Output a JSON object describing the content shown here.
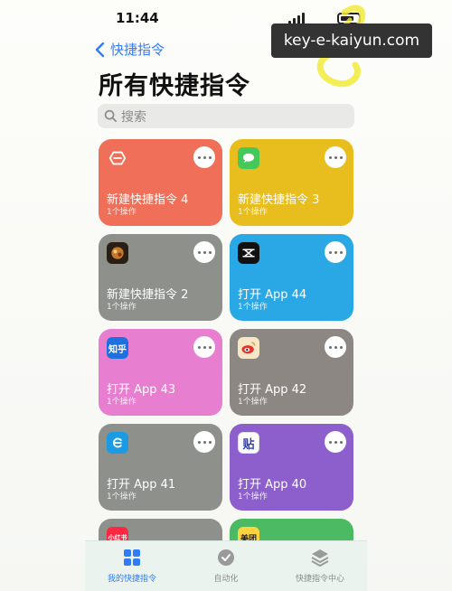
{
  "status_bar": {
    "time": "11:44"
  },
  "watermark": {
    "text": "key-e-kaiyun.com"
  },
  "nav": {
    "back_label": "快捷指令"
  },
  "page": {
    "title": "所有快捷指令"
  },
  "search": {
    "placeholder": "搜索"
  },
  "shortcuts": [
    {
      "name": "新建快捷指令 4",
      "subtitle": "1个操作",
      "color": "#ef6f58",
      "icon": "shortcuts-icon",
      "icon_text": ""
    },
    {
      "name": "新建快捷指令 3",
      "subtitle": "1个操作",
      "color": "#e8be1f",
      "icon": "messages-icon",
      "icon_text": ""
    },
    {
      "name": "新建快捷指令 2",
      "subtitle": "1个操作",
      "color": "#8d908b",
      "icon": "game-app-icon",
      "icon_text": ""
    },
    {
      "name": "打开 App 44",
      "subtitle": "1个操作",
      "color": "#2aa8e6",
      "icon": "capcut-icon",
      "icon_text": ""
    },
    {
      "name": "打开 App 43",
      "subtitle": "1个操作",
      "color": "#e77ecf",
      "icon": "zhihu-icon",
      "icon_text": "知乎"
    },
    {
      "name": "打开 App 42",
      "subtitle": "1个操作",
      "color": "#8d8784",
      "icon": "weibo-icon",
      "icon_text": ""
    },
    {
      "name": "打开 App 41",
      "subtitle": "1个操作",
      "color": "#8d908b",
      "icon": "app-e-icon",
      "icon_text": ""
    },
    {
      "name": "打开 App 40",
      "subtitle": "1个操作",
      "color": "#8c5fcc",
      "icon": "tieba-icon",
      "icon_text": "贴"
    },
    {
      "name": "",
      "subtitle": "",
      "color": "#8d908b",
      "icon": "xiaohongshu-icon",
      "icon_text": "小红书"
    },
    {
      "name": "",
      "subtitle": "",
      "color": "#4bba62",
      "icon": "meituan-icon",
      "icon_text": "美团"
    }
  ],
  "tabbar": {
    "items": [
      {
        "label": "我的快捷指令",
        "icon": "grid-icon",
        "active": true
      },
      {
        "label": "自动化",
        "icon": "clock-check-icon",
        "active": false
      },
      {
        "label": "快捷指令中心",
        "icon": "layers-icon",
        "active": false
      }
    ]
  }
}
